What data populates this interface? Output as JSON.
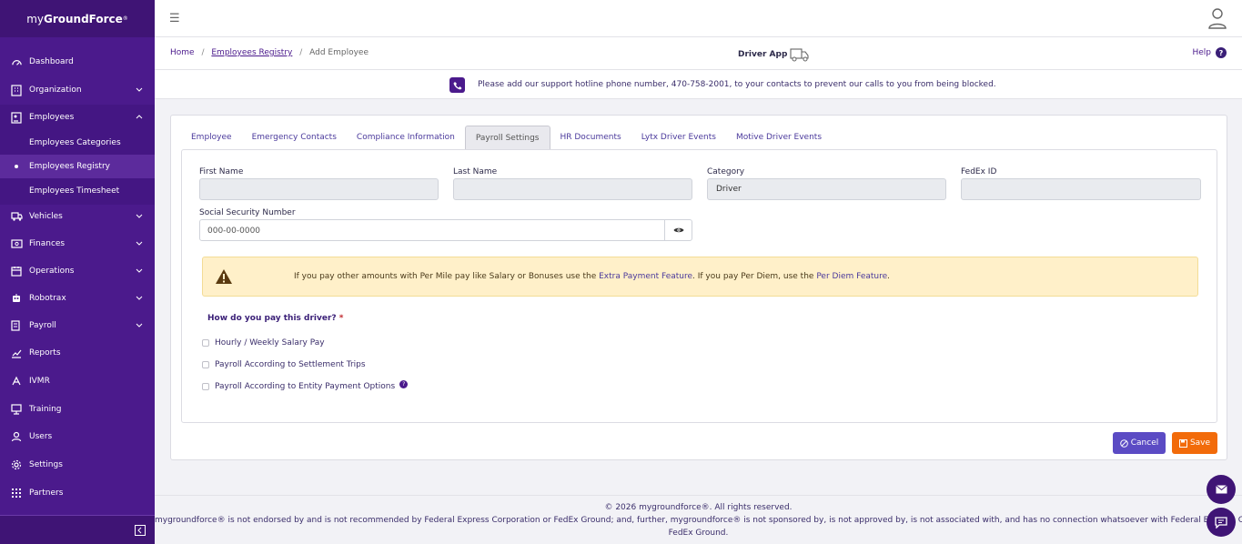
{
  "brand": {
    "prefix": "my",
    "bold": "GroundForce",
    "suffix": "®"
  },
  "sidebar": {
    "items": [
      {
        "label": "Dashboard",
        "icon": "speedometer-icon"
      },
      {
        "label": "Organization",
        "icon": "building-icon"
      },
      {
        "label": "Employees",
        "icon": "id-card-icon"
      },
      {
        "label": "Vehicles",
        "icon": "truck-icon"
      },
      {
        "label": "Finances",
        "icon": "money-icon"
      },
      {
        "label": "Operations",
        "icon": "calendar-icon"
      },
      {
        "label": "Robotrax",
        "icon": "robot-icon"
      },
      {
        "label": "Payroll",
        "icon": "payroll-icon"
      },
      {
        "label": "Reports",
        "icon": "chart-line-icon"
      },
      {
        "label": "IVMR",
        "icon": "ivmr-icon"
      },
      {
        "label": "Training",
        "icon": "training-icon"
      },
      {
        "label": "Users",
        "icon": "users-icon"
      },
      {
        "label": "Settings",
        "icon": "gear-icon"
      },
      {
        "label": "Partners",
        "icon": "grid-icon"
      }
    ],
    "employees_sub": [
      "Employees Categories",
      "Employees Registry",
      "Employees Timesheet"
    ]
  },
  "breadcrumb": {
    "home": "Home",
    "registry": "Employees Registry",
    "current": "Add Employee",
    "sep": "/"
  },
  "header": {
    "driver_app": "Driver App",
    "help": "Help"
  },
  "notice": "Please add our support hotline phone number, 470-758-2001, to your contacts to prevent our calls to you from being blocked.",
  "tabs": [
    "Employee",
    "Emergency Contacts",
    "Compliance Information",
    "Payroll Settings",
    "HR Documents",
    "Lytx Driver Events",
    "Motive Driver Events"
  ],
  "active_tab": "Payroll Settings",
  "form": {
    "first_name": {
      "label": "First Name",
      "value": ""
    },
    "last_name": {
      "label": "Last Name",
      "value": ""
    },
    "category": {
      "label": "Category",
      "value": "Driver"
    },
    "fedex_id": {
      "label": "FedEx ID",
      "value": ""
    },
    "ssn": {
      "label": "Social Security Number",
      "placeholder": "000-00-0000"
    }
  },
  "warning": {
    "part1": "If you pay other amounts with Per Mile pay like Salary or Bonuses use the ",
    "link1": "Extra Payment Feature",
    "part2": ". If you pay Per Diem, use the ",
    "link2": "Per Diem Feature",
    "part3": "."
  },
  "question": {
    "text": "How do you pay this driver?",
    "required_mark": "*"
  },
  "options": [
    "Hourly / Weekly Salary Pay",
    "Payroll According to Settlement Trips",
    "Payroll According to Entity Payment Options"
  ],
  "buttons": {
    "cancel": "Cancel",
    "save": "Save"
  },
  "footer": {
    "line1": "© 2026 mygroundforce®. All rights reserved.",
    "line2": "mygroundforce® is not endorsed by and is not recommended by Federal Express Corporation or FedEx Ground; and, further, mygroundforce® is not sponsored by, is not approved by, is not associated with, and has no connection whatsoever with Federal Express Corporation or",
    "line3": "FedEx Ground."
  },
  "colors": {
    "sidebar": "#4b1a8c",
    "accent": "#5b4bc4",
    "save": "#f26b0a",
    "warning_bg": "#fff0c9"
  }
}
